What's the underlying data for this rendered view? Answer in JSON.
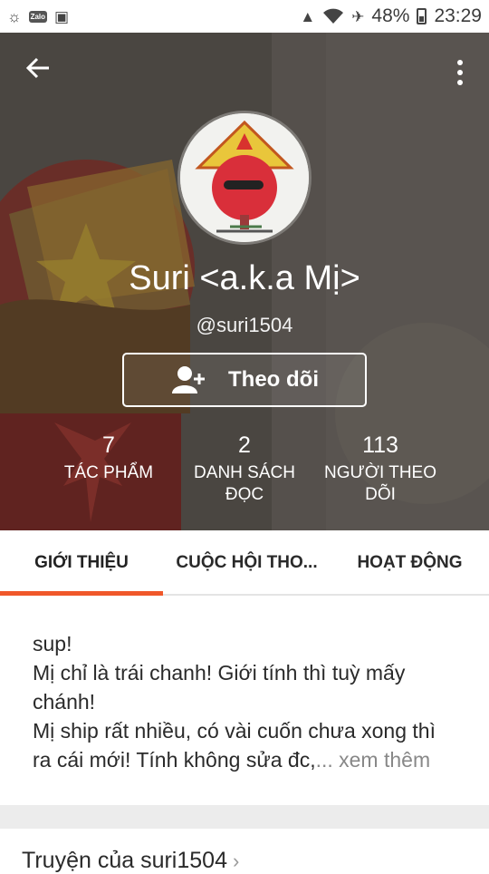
{
  "status_bar": {
    "left_icons": [
      "weather-icon",
      "zalo-icon",
      "clipboard-icon"
    ],
    "zalo_text": "Zalo",
    "battery": "48%",
    "time": "23:29"
  },
  "profile": {
    "display_name": "Suri <a.k.a Mị>",
    "username": "@suri1504",
    "follow_label": "Theo dõi"
  },
  "stats": [
    {
      "value": "7",
      "label_lines": [
        "TÁC PHẨM"
      ]
    },
    {
      "value": "2",
      "label_lines": [
        "DANH SÁCH",
        "ĐỌC"
      ]
    },
    {
      "value": "113",
      "label_lines": [
        "NGƯỜI THEO",
        "DÕI"
      ]
    }
  ],
  "tabs": [
    {
      "label": "GIỚI THIỆU",
      "active": true
    },
    {
      "label": "CUỘC HỘI THO...",
      "active": false
    },
    {
      "label": "HOẠT ĐỘNG",
      "active": false
    }
  ],
  "about": {
    "lines": [
      "sup!",
      "Mị chỉ là trái chanh! Giới tính thì tuỳ mấy chánh!",
      "Mị ship rất nhiều, có vài cuốn chưa xong thì ra cái mới! Tính không sửa đc,"
    ],
    "see_more": "... xem thêm"
  },
  "stories_heading": "Truyện của suri1504",
  "colors": {
    "accent": "#f0582a",
    "text": "#2a2a2a",
    "muted": "#888888"
  }
}
